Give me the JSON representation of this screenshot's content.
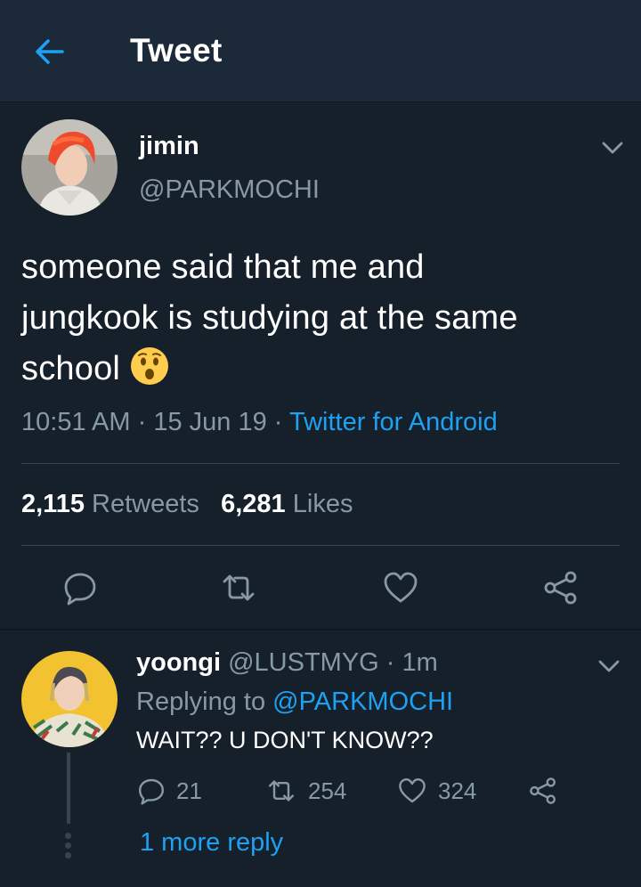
{
  "header": {
    "title": "Tweet"
  },
  "tweet": {
    "name": "jimin",
    "handle": "@PARKMOCHI",
    "text_line1": "someone said that me and",
    "text_line2": "jungkook is studying at the same",
    "text_line3": "school",
    "time": "10:51 AM",
    "sep1": "·",
    "date": "15 Jun 19",
    "sep2": "·",
    "source": "Twitter for Android",
    "retweets_count": "2,115",
    "retweets_label": "Retweets",
    "likes_count": "6,281",
    "likes_label": "Likes"
  },
  "reply": {
    "name": "yoongi",
    "handle": "@LUSTMYG",
    "sep": "·",
    "time": "1m",
    "replying_prefix": "Replying to",
    "replying_to": "@PARKMOCHI",
    "text": "WAIT?? U DON'T KNOW??",
    "replies": "21",
    "retweets": "254",
    "likes": "324",
    "more_replies": "1 more reply"
  },
  "colors": {
    "background": "#15202b",
    "header": "#1c2938",
    "accent": "#1da1f2",
    "secondary_text": "#8899a6",
    "divider": "#38444d"
  },
  "icons": [
    "back-arrow-icon",
    "chevron-down-icon",
    "reply-icon",
    "retweet-icon",
    "like-icon",
    "share-icon",
    "hushed-face-emoji"
  ]
}
